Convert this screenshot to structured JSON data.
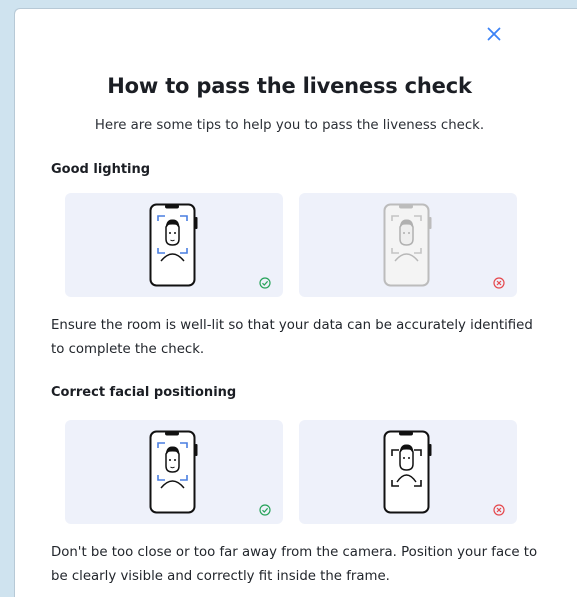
{
  "modal": {
    "close_icon": "close-icon",
    "title": "How to pass the liveness check",
    "subtitle": "Here are some tips to help you to pass the liveness check."
  },
  "sections": [
    {
      "title": "Good lighting",
      "good_example": {
        "status_icon": "check-circle-icon",
        "status_color": "#27a35a"
      },
      "bad_example": {
        "status_icon": "x-circle-icon",
        "status_color": "#e5484d"
      },
      "description": "Ensure the room is well-lit so that your data can be accurately identified to complete the check."
    },
    {
      "title": "Correct facial positioning",
      "good_example": {
        "status_icon": "check-circle-icon",
        "status_color": "#27a35a"
      },
      "bad_example": {
        "status_icon": "x-circle-icon",
        "status_color": "#e5484d"
      },
      "description": "Don't be too close or too far away from the camera. Position your face to be clearly visible and correctly fit inside the frame."
    }
  ],
  "colors": {
    "accent": "#3b82f6",
    "card_background": "#eef1fa",
    "page_background": "#cfe3ef",
    "faded": "#bcbcbc"
  }
}
